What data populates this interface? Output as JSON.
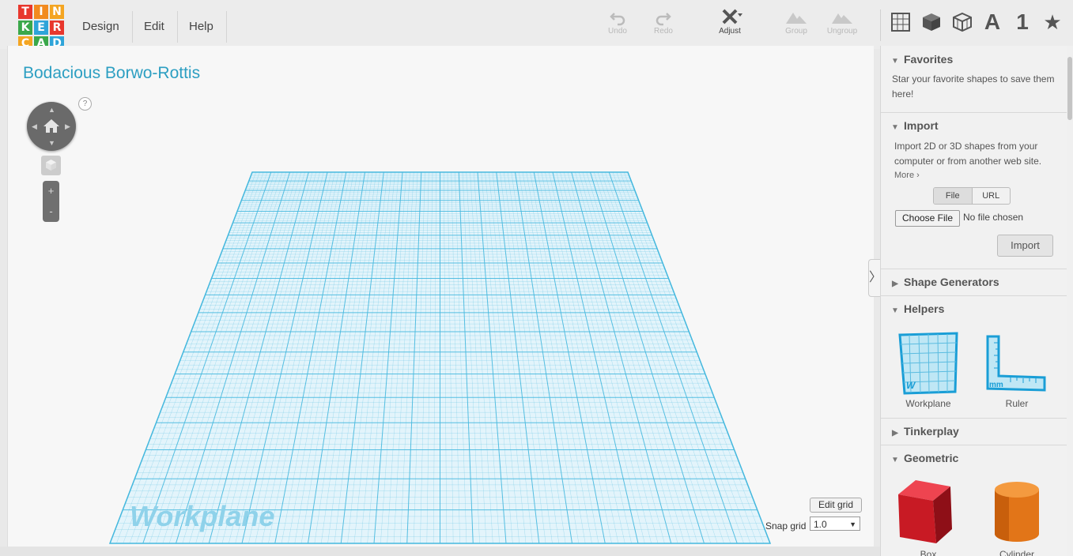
{
  "logo": {
    "letters": [
      "T",
      "I",
      "N",
      "K",
      "E",
      "R",
      "C",
      "A",
      "D"
    ],
    "colors": [
      "#e8372d",
      "#f28a1f",
      "#f4a521",
      "#3aa84a",
      "#2ea4d9",
      "#e8372d",
      "#f4a521",
      "#3aa84a",
      "#2ea4d9"
    ]
  },
  "menu": {
    "design": "Design",
    "edit": "Edit",
    "help": "Help"
  },
  "toolbar": {
    "undo": "Undo",
    "redo": "Redo",
    "adjust": "Adjust",
    "group": "Group",
    "ungroup": "Ungroup"
  },
  "view_icons": [
    "grid-view-icon",
    "solid-view-icon",
    "wireframe-view-icon",
    "text-icon",
    "number-icon",
    "star-icon"
  ],
  "view_text": {
    "a": "A",
    "one": "1",
    "star": "★"
  },
  "canvas": {
    "title": "Bodacious Borwo-Rottis",
    "help": "?",
    "workplane_label": "Workplane",
    "edit_grid": "Edit grid",
    "snap_grid_label": "Snap grid",
    "snap_grid_value": "1.0",
    "zoom_in": "+",
    "zoom_out": "-"
  },
  "panel": {
    "favorites": {
      "title": "Favorites",
      "text": "Star your favorite shapes to save them here!"
    },
    "import": {
      "title": "Import",
      "text": "Import 2D or 3D shapes from your computer or from another web site.",
      "more": "More ›",
      "tab_file": "File",
      "tab_url": "URL",
      "choose_file": "Choose File",
      "no_file": "No file chosen",
      "import_button": "Import"
    },
    "shape_generators": "Shape Generators",
    "helpers": {
      "title": "Helpers",
      "items": [
        "Workplane",
        "Ruler"
      ]
    },
    "tinkerplay": "Tinkerplay",
    "geometric": {
      "title": "Geometric",
      "items": [
        "Box",
        "Cylinder"
      ]
    }
  },
  "colors": {
    "accent": "#2d9fc2",
    "grid": "#45b8de",
    "box": "#d41f2a",
    "cylinder": "#e87b1c"
  }
}
